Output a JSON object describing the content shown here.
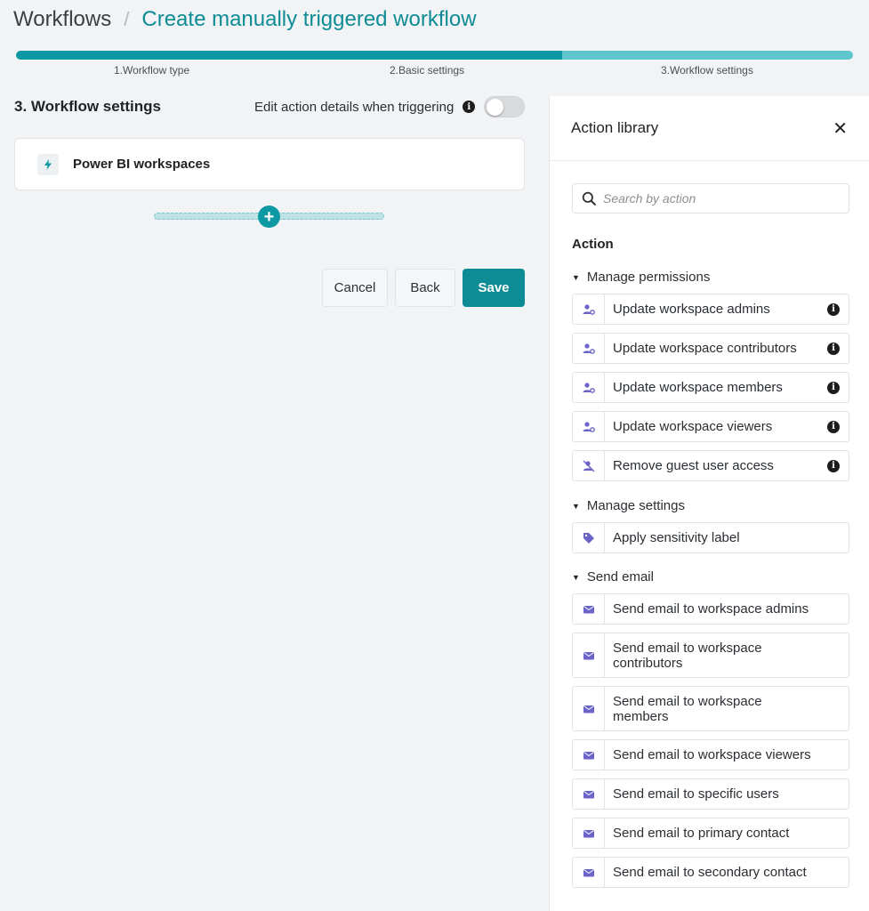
{
  "breadcrumb": {
    "root": "Workflows",
    "separator": "/",
    "current": "Create manually triggered workflow"
  },
  "stepper": {
    "steps": [
      {
        "label": "1.Workflow type",
        "state": "done"
      },
      {
        "label": "2.Basic settings",
        "state": "done"
      },
      {
        "label": "3.Workflow settings",
        "state": "current"
      }
    ]
  },
  "settings": {
    "title": "3. Workflow settings",
    "edit_toggle_label": "Edit action details when triggering",
    "edit_toggle_on": false,
    "trigger_label": "Power BI workspaces"
  },
  "buttons": {
    "cancel": "Cancel",
    "back": "Back",
    "save": "Save"
  },
  "library": {
    "title": "Action library",
    "search_placeholder": "Search by action",
    "action_heading": "Action",
    "groups": [
      {
        "name": "Manage permissions",
        "items": [
          {
            "label": "Update workspace admins",
            "icon": "user-gear-icon",
            "info": true
          },
          {
            "label": "Update workspace contributors",
            "icon": "user-gear-icon",
            "info": true
          },
          {
            "label": "Update workspace members",
            "icon": "user-gear-icon",
            "info": true
          },
          {
            "label": "Update workspace viewers",
            "icon": "user-gear-icon",
            "info": true
          },
          {
            "label": "Remove guest user access",
            "icon": "user-remove-icon",
            "info": true
          }
        ]
      },
      {
        "name": "Manage settings",
        "items": [
          {
            "label": "Apply sensitivity label",
            "icon": "tag-icon",
            "info": false
          }
        ]
      },
      {
        "name": "Send email",
        "items": [
          {
            "label": "Send email to workspace admins",
            "icon": "mail-icon",
            "info": false
          },
          {
            "label": "Send email to workspace contributors",
            "icon": "mail-icon",
            "info": false
          },
          {
            "label": "Send email to workspace members",
            "icon": "mail-icon",
            "info": false
          },
          {
            "label": "Send email to workspace viewers",
            "icon": "mail-icon",
            "info": false
          },
          {
            "label": "Send email to specific users",
            "icon": "mail-icon",
            "info": false
          },
          {
            "label": "Send email to primary contact",
            "icon": "mail-icon",
            "info": false
          },
          {
            "label": "Send email to secondary contact",
            "icon": "mail-icon",
            "info": false
          }
        ]
      }
    ]
  },
  "colors": {
    "accent": "#0e8c95",
    "progress_done": "#0c99a3",
    "progress_current": "#5fc6cd",
    "icon_purple": "#6b63c7"
  }
}
